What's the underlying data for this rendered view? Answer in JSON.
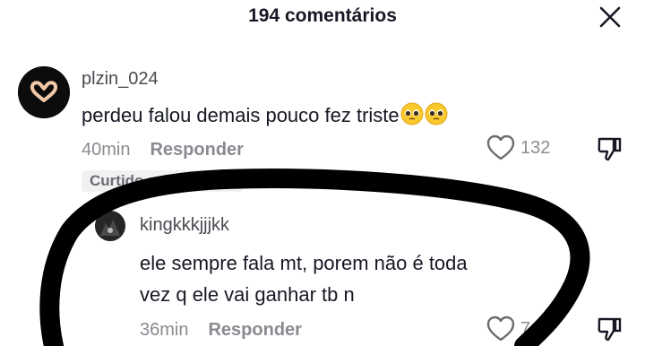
{
  "header": {
    "title": "194 comentários"
  },
  "comments": [
    {
      "username": "plzin_024",
      "text": "perdeu falou demais pouco fez triste",
      "emojis": [
        "pleading-face",
        "pleading-face"
      ],
      "time": "40min",
      "reply_label": "Responder",
      "likes": "132",
      "badge": "Curtido pelo criador"
    },
    {
      "username": "kingkkkjjjkk",
      "text_line1": "ele sempre fala mt, porem não é toda",
      "text_line2": "vez q ele vai ganhar tb n",
      "time": "36min",
      "reply_label": "Responder",
      "likes": "7"
    }
  ],
  "colors": {
    "text": "#161823",
    "muted": "#8a8b91",
    "badge_bg": "#f1f1f2"
  }
}
